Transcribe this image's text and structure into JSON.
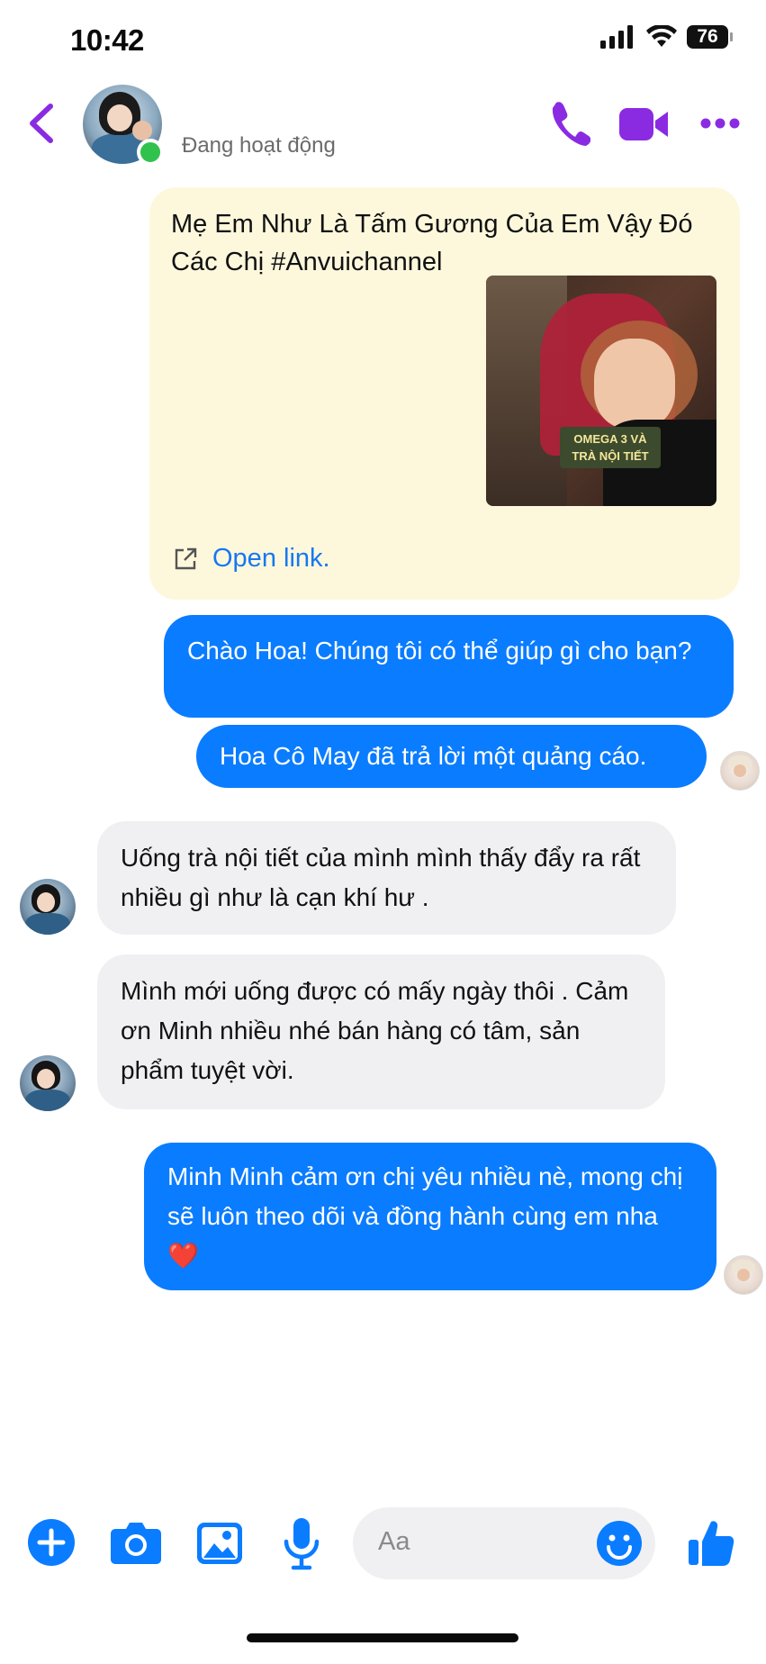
{
  "status_bar": {
    "time": "10:42",
    "battery": "76"
  },
  "header": {
    "presence": "Đang hoạt động"
  },
  "link_preview": {
    "title": "Mẹ Em Như Là Tấm Gương Của Em Vậy Đó Các Chị #Anvuichannel",
    "thumbnail_caption_line1": "OMEGA 3 VÀ",
    "thumbnail_caption_line2": "TRÀ NỘI TIẾT",
    "open_link_label": "Open link."
  },
  "messages": [
    {
      "from": "me",
      "text": "Chào Hoa! Chúng tôi có thể giúp gì cho bạn?"
    },
    {
      "from": "me",
      "text": "Hoa Cô May đã trả lời một quảng cáo."
    },
    {
      "from": "them",
      "text": "Uống trà nội tiết của mình mình thấy đẩy ra rất nhiều gì như là cạn khí hư ."
    },
    {
      "from": "them",
      "text": "Mình mới uống được có mấy ngày thôi . Cảm ơn Minh nhiều nhé bán hàng có tâm, sản phẩm tuyệt vời."
    },
    {
      "from": "me",
      "text": "Minh Minh cảm ơn chị yêu nhiều nè, mong chị sẽ luôn theo dõi và đồng hành cùng em nha",
      "emoji": "❤️"
    }
  ],
  "composer": {
    "placeholder": "Aa"
  },
  "colors": {
    "accent_purple": "#8a2be2",
    "bubble_blue": "#0a7cff",
    "link_blue": "#1678f2",
    "online_green": "#31c24d"
  }
}
